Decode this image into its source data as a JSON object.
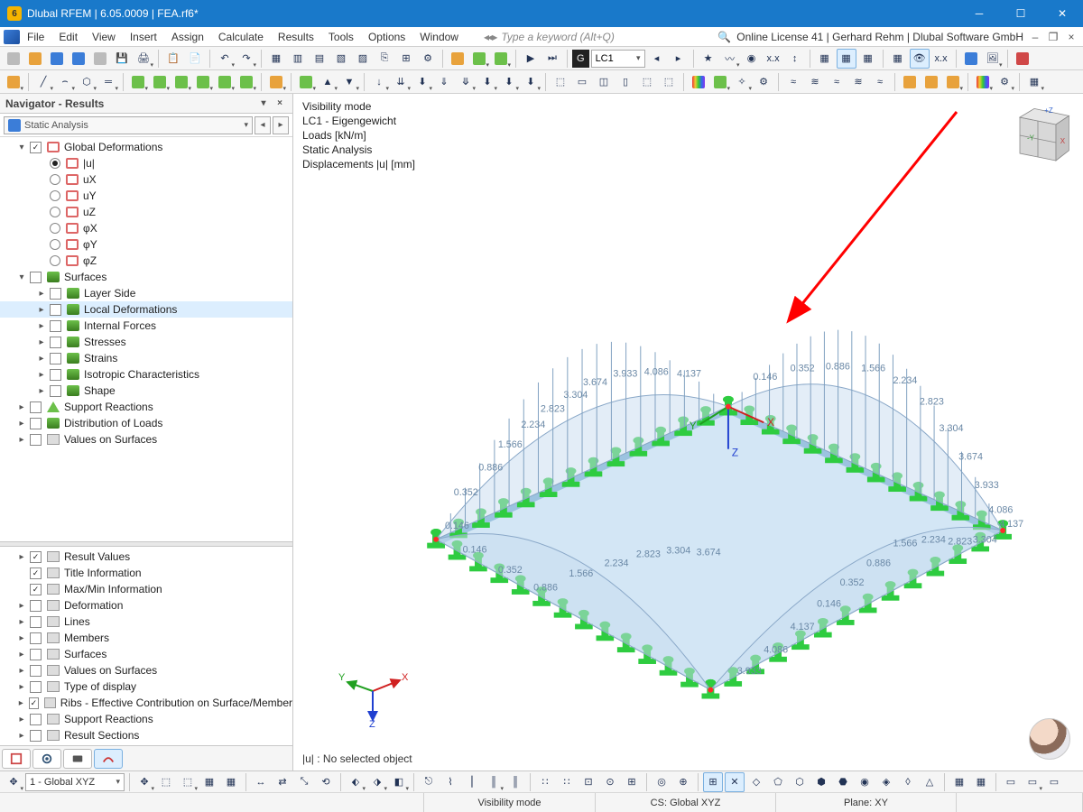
{
  "titlebar": {
    "title": "Dlubal RFEM | 6.05.0009 | FEA.rf6*"
  },
  "menubar": {
    "items": [
      "File",
      "Edit",
      "View",
      "Insert",
      "Assign",
      "Calculate",
      "Results",
      "Tools",
      "Options",
      "Window"
    ],
    "search_placeholder": "Type a keyword (Alt+Q)",
    "right_info": "Online License 41 | Gerhard Rehm | Dlubal Software GmbH"
  },
  "toolbar1": {
    "loadcase_label": "LC1",
    "g_label": "G"
  },
  "sidebar": {
    "title": "Navigator - Results",
    "combo": "Static Analysis",
    "tree_top": [
      {
        "exp": "-",
        "chk": true,
        "icon": "def",
        "label": "Global Deformations",
        "indent": 1
      },
      {
        "radio": true,
        "sel": true,
        "icon": "def",
        "label": "|u|",
        "indent": 2
      },
      {
        "radio": true,
        "icon": "def",
        "label": "uX",
        "indent": 2
      },
      {
        "radio": true,
        "icon": "def",
        "label": "uY",
        "indent": 2
      },
      {
        "radio": true,
        "icon": "def",
        "label": "uZ",
        "indent": 2
      },
      {
        "radio": true,
        "icon": "def",
        "label": "φX",
        "indent": 2
      },
      {
        "radio": true,
        "icon": "def",
        "label": "φY",
        "indent": 2
      },
      {
        "radio": true,
        "icon": "def",
        "label": "φZ",
        "indent": 2
      },
      {
        "exp": "-",
        "chk": false,
        "icon": "surf",
        "label": "Surfaces",
        "indent": 1
      },
      {
        "exp": ">",
        "chk": false,
        "icon": "surf",
        "label": "Layer Side",
        "indent": 2
      },
      {
        "exp": ">",
        "chk": false,
        "icon": "surf",
        "label": "Local Deformations",
        "indent": 2,
        "selrow": true
      },
      {
        "exp": ">",
        "chk": false,
        "icon": "surf",
        "label": "Internal Forces",
        "indent": 2
      },
      {
        "exp": ">",
        "chk": false,
        "icon": "surf",
        "label": "Stresses",
        "indent": 2
      },
      {
        "exp": ">",
        "chk": false,
        "icon": "surf",
        "label": "Strains",
        "indent": 2
      },
      {
        "exp": ">",
        "chk": false,
        "icon": "surf",
        "label": "Isotropic Characteristics",
        "indent": 2
      },
      {
        "exp": ">",
        "chk": false,
        "icon": "surf",
        "label": "Shape",
        "indent": 2
      },
      {
        "exp": ">",
        "chk": false,
        "icon": "sup",
        "label": "Support Reactions",
        "indent": 1
      },
      {
        "exp": ">",
        "chk": false,
        "icon": "surf",
        "label": "Distribution of Loads",
        "indent": 1
      },
      {
        "exp": ">",
        "chk": false,
        "icon": "val",
        "label": "Values on Surfaces",
        "indent": 1
      }
    ],
    "tree_bottom": [
      {
        "exp": ">",
        "chk": true,
        "label": "Result Values"
      },
      {
        "exp": "",
        "chk": true,
        "label": "Title Information"
      },
      {
        "exp": "",
        "chk": true,
        "label": "Max/Min Information"
      },
      {
        "exp": ">",
        "chk": false,
        "label": "Deformation"
      },
      {
        "exp": ">",
        "chk": false,
        "label": "Lines"
      },
      {
        "exp": ">",
        "chk": false,
        "label": "Members"
      },
      {
        "exp": ">",
        "chk": false,
        "label": "Surfaces"
      },
      {
        "exp": ">",
        "chk": false,
        "label": "Values on Surfaces"
      },
      {
        "exp": ">",
        "chk": false,
        "label": "Type of display"
      },
      {
        "exp": ">",
        "chk": true,
        "label": "Ribs - Effective Contribution on Surface/Member"
      },
      {
        "exp": ">",
        "chk": false,
        "label": "Support Reactions"
      },
      {
        "exp": ">",
        "chk": false,
        "label": "Result Sections"
      }
    ]
  },
  "viewport": {
    "info_lines": [
      "Visibility mode",
      "LC1 - Eigengewicht",
      "Loads [kN/m]",
      "Static Analysis",
      "Displacements |u| [mm]"
    ],
    "selection_status": "|u| : No selected object",
    "diagram_values": [
      "0.146",
      "0.352",
      "0.886",
      "1.566",
      "2.234",
      "2.823",
      "3.304",
      "3.674",
      "3.933",
      "4.086",
      "4.137"
    ]
  },
  "bottombar": {
    "cs_combo": "1 - Global XYZ"
  },
  "statusbar": {
    "cells": [
      "",
      "Visibility mode",
      "CS: Global XYZ",
      "Plane: XY",
      ""
    ]
  }
}
